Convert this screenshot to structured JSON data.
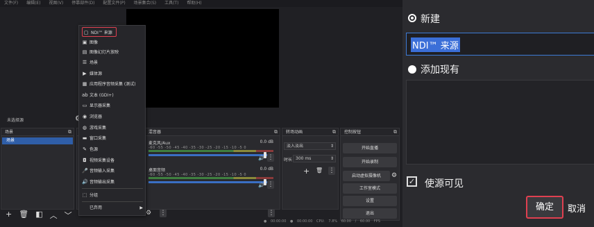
{
  "menubar": {
    "items": [
      "文件(F)",
      "编辑(E)",
      "视图(V)",
      "停靠部件(D)",
      "配置文件(P)",
      "场景集合(S)",
      "工具(T)",
      "帮助(H)"
    ]
  },
  "sources": {
    "empty_label": "未选择源"
  },
  "scenes": {
    "title": "场景",
    "items": [
      "场景"
    ]
  },
  "mixer": {
    "title": "混音器",
    "channels": [
      {
        "name": "麦克风/Aux",
        "db": "0.0 dB"
      },
      {
        "name": "桌面音频",
        "db": "0.0 dB"
      }
    ],
    "ticks": "-60 -55 -50 -45 -40 -35 -30 -25 -20 -15 -10 -5 0"
  },
  "transitions": {
    "title": "转场动画",
    "type": "淡入淡出",
    "duration_label": "时长",
    "duration": "300 ms"
  },
  "controls": {
    "title": "控制按钮",
    "buttons": [
      "开始直播",
      "开始录制",
      "启动虚拟摄像机",
      "工作室模式",
      "设置",
      "退出"
    ]
  },
  "status": {
    "text": "● 00:00:00   ● 00:00:00   CPU: 7.8%   60.00 / 60.00 FPS"
  },
  "context_menu": {
    "items": [
      {
        "label": "NDI™ 来源",
        "icon": "ndi-icon",
        "highlight": true
      },
      {
        "label": "图像",
        "icon": "image-icon"
      },
      {
        "label": "图像幻灯片放映",
        "icon": "slideshow-icon"
      },
      {
        "label": "场景",
        "icon": "scene-list-icon"
      },
      {
        "label": "媒体源",
        "icon": "play-icon"
      },
      {
        "label": "应用程序音频采集 (测试)",
        "icon": "app-audio-icon"
      },
      {
        "label": "文本 (GDI+)",
        "icon": "text-icon"
      },
      {
        "label": "显示器采集",
        "icon": "monitor-icon"
      },
      {
        "label": "浏览器",
        "icon": "globe-icon"
      },
      {
        "label": "游戏采集",
        "icon": "gamepad-icon"
      },
      {
        "label": "窗口采集",
        "icon": "window-icon"
      },
      {
        "label": "色源",
        "icon": "brush-icon"
      },
      {
        "label": "视频采集设备",
        "icon": "camera-icon"
      },
      {
        "label": "音频输入采集",
        "icon": "mic-icon"
      },
      {
        "label": "音频输出采集",
        "icon": "speaker-icon"
      },
      {
        "label": "分组",
        "icon": "group-icon"
      },
      {
        "label": "已弃用",
        "icon": "chevron-right-icon"
      }
    ]
  },
  "dialog": {
    "new_label": "新建",
    "name_value": "NDI™ 来源",
    "existing_label": "添加现有",
    "visible_label": "使源可见",
    "ok": "确定",
    "cancel": "取消"
  },
  "colors": {
    "accent": "#3b6fd8",
    "highlight_border": "#e04050",
    "selection": "#2f5ea8"
  }
}
